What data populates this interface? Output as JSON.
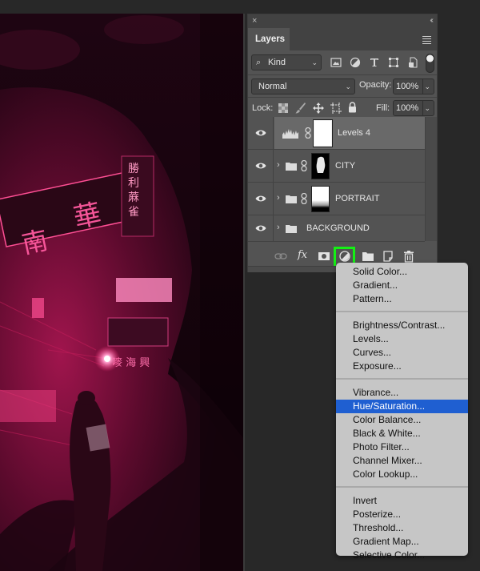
{
  "panel": {
    "close_glyph": "×",
    "collapse_glyph": "‹‹",
    "tab_label": "Layers",
    "filter": {
      "icon": "search-icon",
      "value": "Kind"
    },
    "filter_icons": [
      "image-filter-icon",
      "adjustment-filter-icon",
      "type-filter-icon",
      "shape-filter-icon",
      "smart-object-filter-icon",
      "filter-toggle-icon"
    ],
    "blend_mode": "Normal",
    "opacity_label": "Opacity:",
    "opacity_value": "100%",
    "lock_label": "Lock:",
    "lock_icons": [
      "lock-transparent-pixels-icon",
      "lock-image-pixels-icon",
      "lock-position-icon",
      "lock-artboard-icon",
      "lock-all-icon"
    ],
    "fill_label": "Fill:",
    "fill_value": "100%",
    "layers": [
      {
        "name": "Levels 4",
        "type": "adjustment-levels",
        "visible": true,
        "selected": true
      },
      {
        "name": "CITY",
        "type": "group",
        "visible": true,
        "selected": false
      },
      {
        "name": "PORTRAIT",
        "type": "group",
        "visible": true,
        "selected": false
      },
      {
        "name": "BACKGROUND",
        "type": "group",
        "visible": true,
        "selected": false
      }
    ],
    "footer_buttons": [
      "link-layers",
      "add-layer-style",
      "add-mask",
      "new-fill-adjustment-layer",
      "new-group",
      "new-layer",
      "delete-layer"
    ],
    "expand_glyph": "›",
    "fx_label": "fx"
  },
  "adjustment_menu": {
    "groups": [
      [
        "Solid Color...",
        "Gradient...",
        "Pattern..."
      ],
      [
        "Brightness/Contrast...",
        "Levels...",
        "Curves...",
        "Exposure..."
      ],
      [
        "Vibrance...",
        "Hue/Saturation...",
        "Color Balance...",
        "Black & White...",
        "Photo Filter...",
        "Channel Mixer...",
        "Color Lookup..."
      ],
      [
        "Invert",
        "Posterize...",
        "Threshold...",
        "Gradient Map...",
        "Selective Color..."
      ]
    ],
    "highlighted": "Hue/Saturation..."
  },
  "colors": {
    "highlight_outline": "#14f014",
    "menu_selection": "#1f5fd1",
    "neon_pink": "#ff2d7a"
  }
}
